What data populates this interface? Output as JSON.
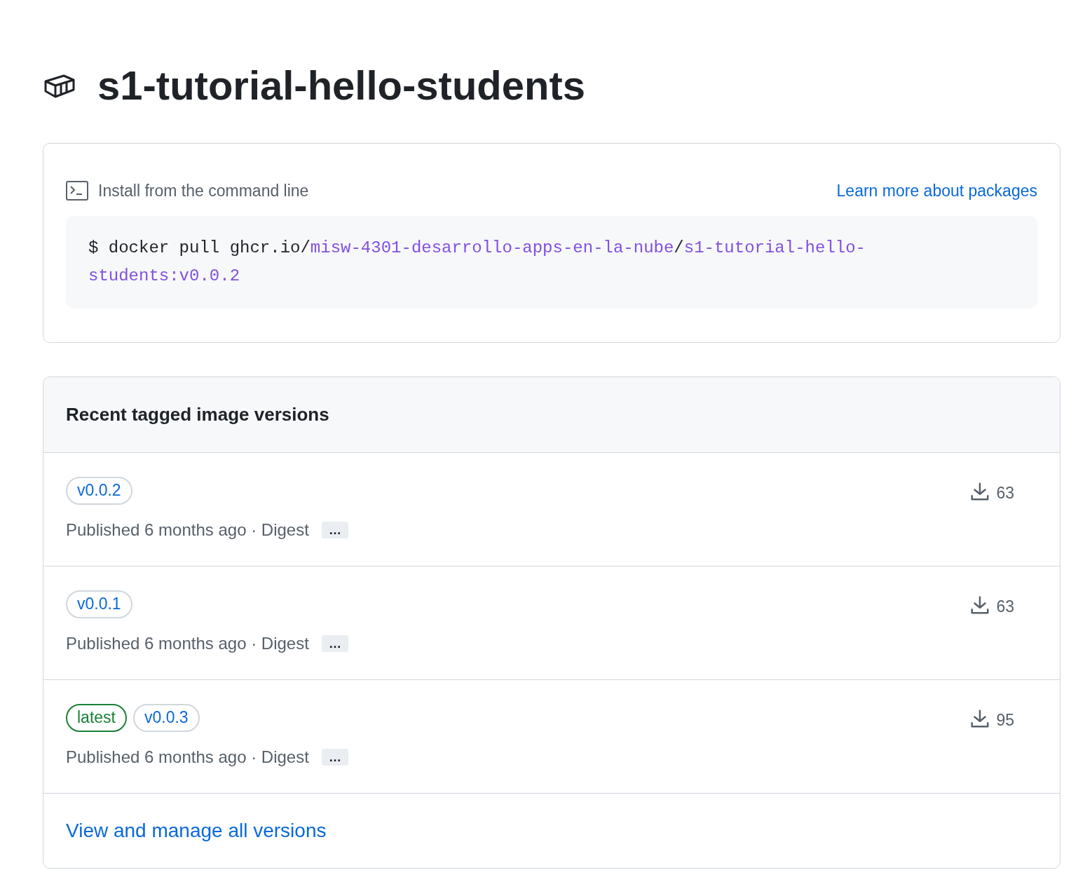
{
  "title": "s1-tutorial-hello-students",
  "install": {
    "label": "Install from the command line",
    "link": "Learn more about packages",
    "command": [
      {
        "kind": "plain",
        "text": "$ docker pull ghcr.io/"
      },
      {
        "kind": "link",
        "text": "misw-4301-desarrollo-apps-en-la-nube"
      },
      {
        "kind": "plain",
        "text": "/"
      },
      {
        "kind": "link",
        "text": "s1-tutorial-hello-students:v0.0.2"
      }
    ]
  },
  "versions": {
    "heading": "Recent tagged image versions",
    "rows": [
      {
        "tags": [
          {
            "kind": "version",
            "text": "v0.0.2"
          }
        ],
        "published": "Published 6 months ago · Digest",
        "more": "…",
        "downloads": "63"
      },
      {
        "tags": [
          {
            "kind": "version",
            "text": "v0.0.1"
          }
        ],
        "published": "Published 6 months ago · Digest",
        "more": "…",
        "downloads": "63"
      },
      {
        "tags": [
          {
            "kind": "latest",
            "text": "latest"
          },
          {
            "kind": "version",
            "text": "v0.0.3"
          }
        ],
        "published": "Published 6 months ago · Digest",
        "more": "…",
        "downloads": "95"
      }
    ],
    "footer_link": "View and manage all versions"
  }
}
